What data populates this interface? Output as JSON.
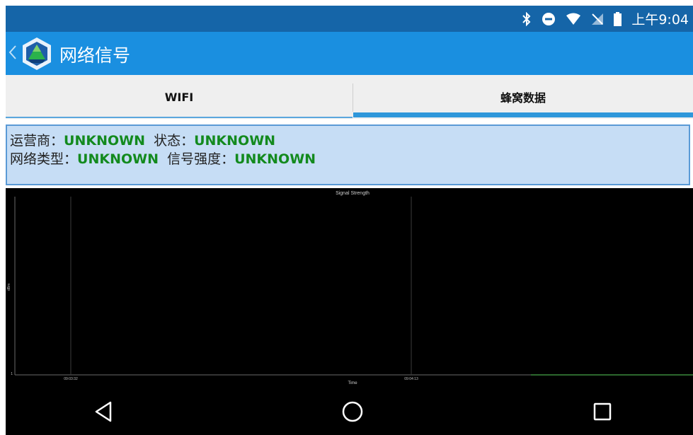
{
  "status_bar": {
    "time": "上午9:04",
    "icons": [
      "bluetooth-icon",
      "do-not-disturb-icon",
      "wifi-icon",
      "no-sim-icon",
      "battery-icon"
    ]
  },
  "app_bar": {
    "title": "网络信号",
    "icons": [
      "back-chevron-icon",
      "app-logo-icon"
    ]
  },
  "tabs": [
    {
      "label": "WIFI",
      "selected": false
    },
    {
      "label": "蜂窝数据",
      "selected": true
    }
  ],
  "info": {
    "carrier_label": "运营商：",
    "carrier_value": "UNKNOWN",
    "state_label": "状态：",
    "state_value": "UNKNOWN",
    "network_type_label": "网络类型：",
    "network_type_value": "UNKNOWN",
    "signal_label": "信号强度：",
    "signal_value": "UNKNOWN"
  },
  "chart_data": {
    "type": "line",
    "title": "Signal Strength",
    "xlabel": "Time",
    "ylabel": "dBm",
    "x_ticks": [
      "09:03:32",
      "09:04:13"
    ],
    "y_ticks": [
      "1"
    ],
    "series": [],
    "grid": true
  },
  "nav_bar": {
    "buttons": [
      "back-triangle-icon",
      "home-circle-icon",
      "recents-square-icon"
    ]
  },
  "colors": {
    "status_bar": "#1565a8",
    "app_bar": "#1a8fe0",
    "value_green": "#138a1e",
    "info_panel": "#c6ddf5"
  }
}
